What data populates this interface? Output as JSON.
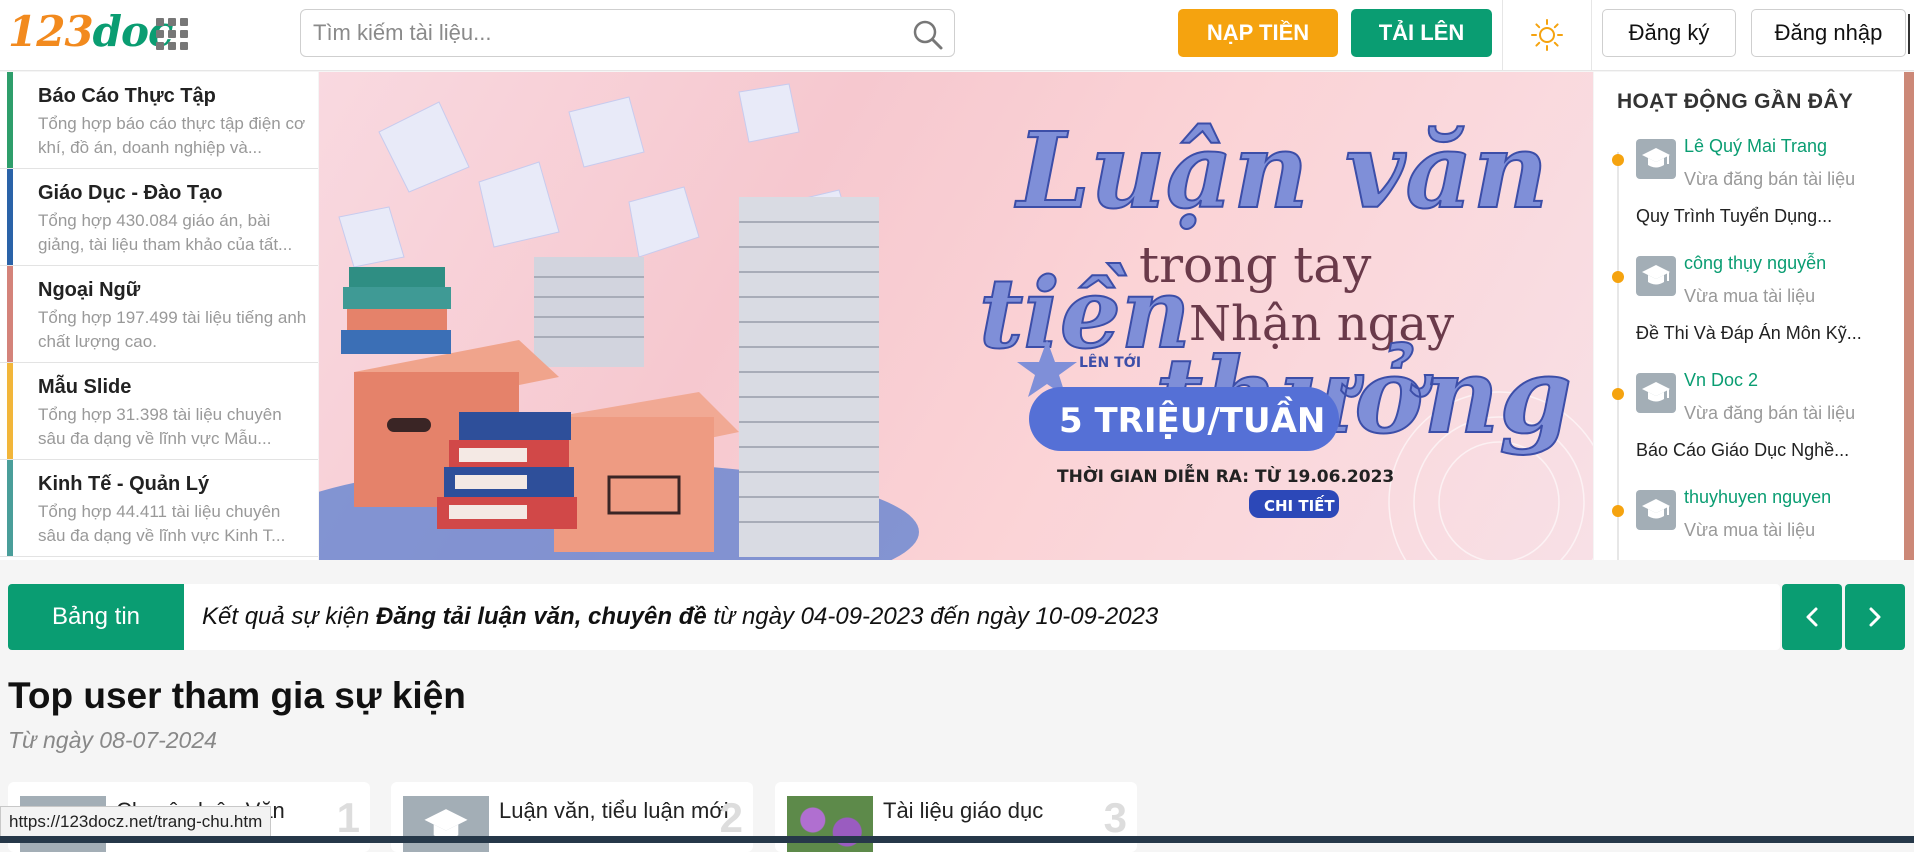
{
  "header": {
    "logo_part1": "123",
    "logo_part2": "doc",
    "search_placeholder": "Tìm kiếm tài liệu...",
    "topup_label": "NẠP TIỀN",
    "upload_label": "TẢI LÊN",
    "register_label": "Đăng ký",
    "login_label": "Đăng nhập"
  },
  "categories": [
    {
      "title": "Báo Cáo Thực Tập",
      "desc": "Tổng hợp báo cáo thực tập điện cơ khí, đồ án, doanh nghiệp và...",
      "color": "#2e9e6b"
    },
    {
      "title": "Giáo Dục - Đào Tạo",
      "desc": "Tổng hợp 430.084 giáo án, bài giảng, tài liệu tham khảo của tất...",
      "color": "#2a63a8"
    },
    {
      "title": "Ngoại Ngữ",
      "desc": "Tổng hợp 197.499 tài liệu tiếng anh chất lượng cao.",
      "color": "#d4837a"
    },
    {
      "title": "Mẫu Slide",
      "desc": "Tổng hợp 31.398 tài liệu chuyên sâu đa dạng về lĩnh vực Mẫu...",
      "color": "#f2b63a"
    },
    {
      "title": "Kinh Tế - Quản Lý",
      "desc": "Tổng hợp 44.411 tài liệu chuyên sâu đa dạng về lĩnh vực Kinh T...",
      "color": "#4a9e9a"
    }
  ],
  "banner": {
    "line1": "Luận văn",
    "line2": "trong tay",
    "line3": "Nhận ngay",
    "line4": "tiền",
    "line5": "thưởng",
    "up_to": "LÊN TỚI",
    "prize": "5 TRIỆU/TUẦN",
    "time": "THỜI GIAN DIỄN RA: TỪ 19.06.2023",
    "detail": "CHI TIẾT"
  },
  "activity": {
    "title": "HOẠT ĐỘNG GẦN ĐÂY",
    "items": [
      {
        "user": "Lê Quý Mai Trang",
        "action": "Vừa đăng bán tài liệu",
        "doc": "Quy Trình Tuyển Dụng..."
      },
      {
        "user": "công thụy nguyễn",
        "action": "Vừa mua tài liệu",
        "doc": "Đề Thi Và Đáp Án Môn Kỹ..."
      },
      {
        "user": "Vn Doc 2",
        "action": "Vừa đăng bán tài liệu",
        "doc": "Báo Cáo Giáo Dục Nghề..."
      },
      {
        "user": "thuyhuyen nguyen",
        "action": "Vừa mua tài liệu",
        "doc": ""
      }
    ]
  },
  "news": {
    "label": "Bảng tin",
    "text_pre": "Kết quả sự kiện ",
    "text_bold": "Đăng tải luận văn, chuyên đề",
    "text_post": " từ ngày 04-09-2023 đến ngày 10-09-2023"
  },
  "top_users": {
    "title": "Top user tham gia sự kiện",
    "subtitle": "Từ ngày 08-07-2024",
    "cards": [
      {
        "title": "Chuyên luận Văn",
        "rank": "1"
      },
      {
        "title": "Luận văn, tiểu luận mới",
        "rank": "2"
      },
      {
        "title": "Tài liệu giáo dục",
        "rank": "3"
      }
    ]
  },
  "status_url": "https://123docz.net/trang-chu.htm",
  "colors": {
    "accent_green": "#0a9d72",
    "accent_orange": "#f5a30f"
  }
}
